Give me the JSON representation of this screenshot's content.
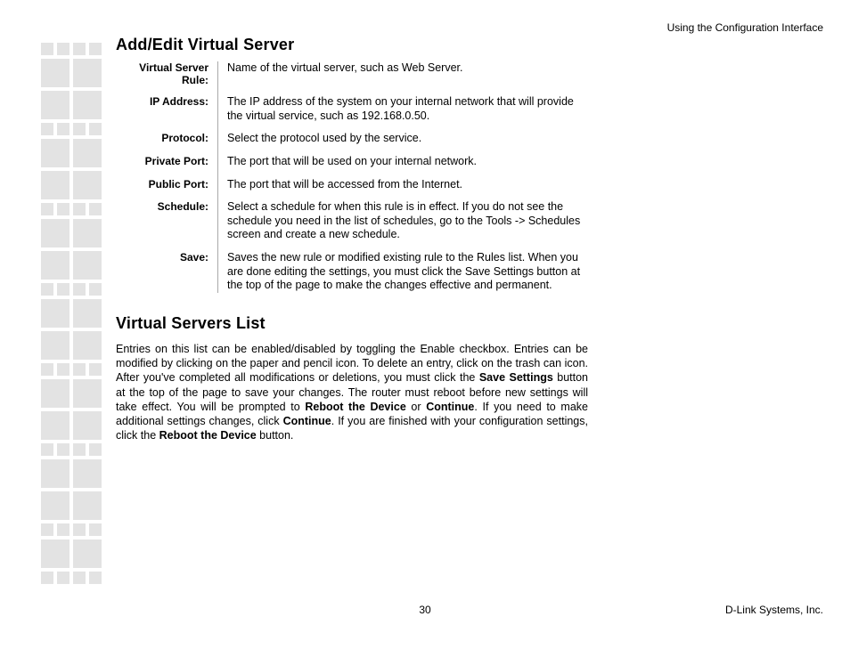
{
  "header_note": "Using the Configuration Interface",
  "section1_title": "Add/Edit Virtual Server",
  "defs": [
    {
      "term": "Virtual Server Rule:",
      "desc": "Name of the virtual server, such as Web Server."
    },
    {
      "term": "IP Address:",
      "desc": "The IP address of the system on your internal network that will provide the virtual service, such as 192.168.0.50."
    },
    {
      "term": "Protocol:",
      "desc": "Select the protocol used by the service."
    },
    {
      "term": "Private Port:",
      "desc": "The port that will be used on your internal network."
    },
    {
      "term": "Public Port:",
      "desc": "The port that will be accessed from the Internet."
    },
    {
      "term": "Schedule:",
      "desc": "Select a schedule for when this rule is in effect. If you do not see the schedule you need in the list of schedules, go to the Tools -> Schedules screen and create a new schedule."
    },
    {
      "term": "Save:",
      "desc": "Saves the new rule or modified existing rule to the Rules list. When you are done editing the settings, you must click the Save Settings button at the top of the page to make the changes effective and permanent."
    }
  ],
  "section2_title": "Virtual Servers List",
  "body": {
    "p1a": "Entries on this list can be enabled/disabled by toggling the Enable checkbox. Entries can be modified by clicking on the paper and pencil icon. To delete an entry, click on the trash can icon. After you've completed all modifications or deletions, you must click the ",
    "b1": "Save Settings",
    "p1b": " button at the top of the page to save your changes. The router must reboot before new settings will take effect. You will be prompted to ",
    "b2": "Reboot the Device",
    "p1c": " or ",
    "b3": "Continue",
    "p1d": ". If you need to make additional settings changes, click ",
    "b4": "Continue",
    "p1e": ". If you are finished with your configuration settings, click the ",
    "b5": "Reboot the Device",
    "p1f": " button."
  },
  "page_number": "30",
  "company": "D-Link Systems, Inc."
}
